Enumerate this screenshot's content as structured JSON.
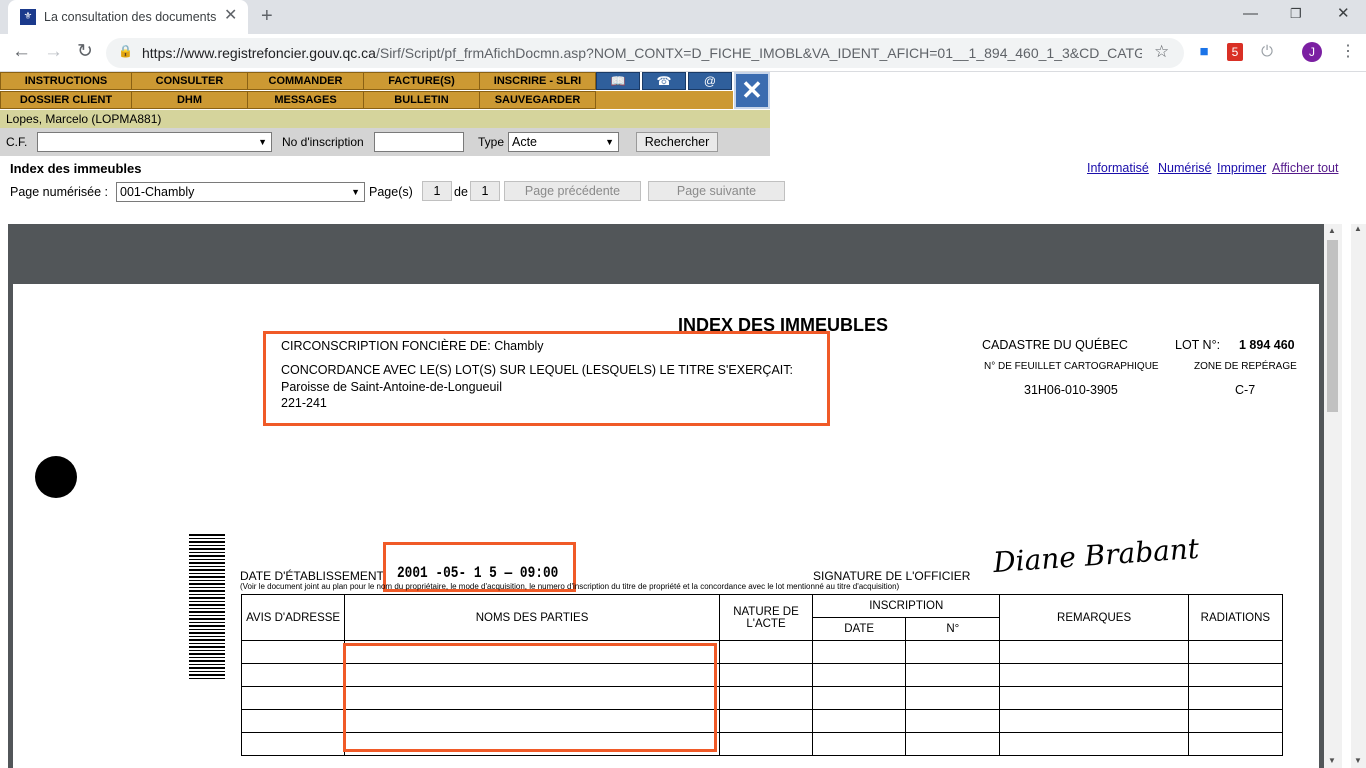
{
  "browser": {
    "tab_title": "La consultation des documents d",
    "tab_favicon": "quebec-fleur-de-lis-icon",
    "url_host": "https://www.registrefoncier.gouv.qc.ca",
    "url_path": "/Sirf/Script/pf_frmAfichDocmn.asp?NOM_CONTX=D_FICHE_IMOBL&VA_IDENT_AFICH=01__1_894_460_1_3&CD_CATGR_P...",
    "profile_initial": "J",
    "extension_badge": "5"
  },
  "menu": {
    "row1": [
      "INSTRUCTIONS",
      "CONSULTER",
      "COMMANDER",
      "FACTURE(S)",
      "INSCRIRE - SLRI"
    ],
    "row2": [
      "DOSSIER CLIENT",
      "DHM",
      "MESSAGES",
      "BULLETIN",
      "SAUVEGARDER"
    ]
  },
  "user": "Lopes, Marcelo (LOPMA881)",
  "search": {
    "cf_label": "C.F.",
    "cf_value": "",
    "no_inscription_label": "No d'inscription",
    "type_label": "Type",
    "type_value": "Acte",
    "search_button": "Rechercher"
  },
  "index": {
    "title": "Index des immeubles",
    "page_label": "Page numérisée :",
    "page_value": "001-Chambly",
    "pages_label": "Page(s)",
    "page_current": "1",
    "of_label": "de",
    "page_total": "1",
    "prev_button": "Page précédente",
    "next_button": "Page suivante",
    "links": [
      "Informatisé",
      "Numérisé",
      "Imprimer",
      "Afficher tout"
    ]
  },
  "document": {
    "heading": "INDEX DES IMMEUBLES",
    "circonscription": "CIRCONSCRIPTION FONCIÈRE DE: Chambly",
    "concordance": "CONCORDANCE AVEC LE(S) LOT(S) SUR LEQUEL (LESQUELS) LE TITRE S'EXERÇAIT:",
    "paroisse": "Paroisse de Saint-Antoine-de-Longueuil",
    "lots": "221-241",
    "cadastre": "CADASTRE DU QUÉBEC",
    "lot_label": "LOT N°:",
    "lot_value": "1 894 460",
    "feuillet_label": "N° DE FEUILLET CARTOGRAPHIQUE",
    "feuillet_value": "31H06-010-3905",
    "zone_label": "ZONE DE REPÉRAGE",
    "zone_value": "C-7",
    "date_label": "DATE D'ÉTABLISSEMENT:",
    "date_value": "2001 -05- 1 5 — 09:00",
    "signature_label": "SIGNATURE DE L'OFFICIER",
    "signature": "Diane Brabant",
    "note": "(Voir le document joint au plan pour le nom du propriétaire, le mode d'acquisition, le numero d'inscription du titre de propriété et la concordance avec le lot mentionné au titre d'acquisition)",
    "columns": {
      "avis": "AVIS D'ADRESSE",
      "noms": "NOMS DES PARTIES",
      "nature": "NATURE DE L'ACTE",
      "inscription": "INSCRIPTION",
      "date": "DATE",
      "no": "N°",
      "remarques": "REMARQUES",
      "radiations": "RADIATIONS"
    }
  }
}
